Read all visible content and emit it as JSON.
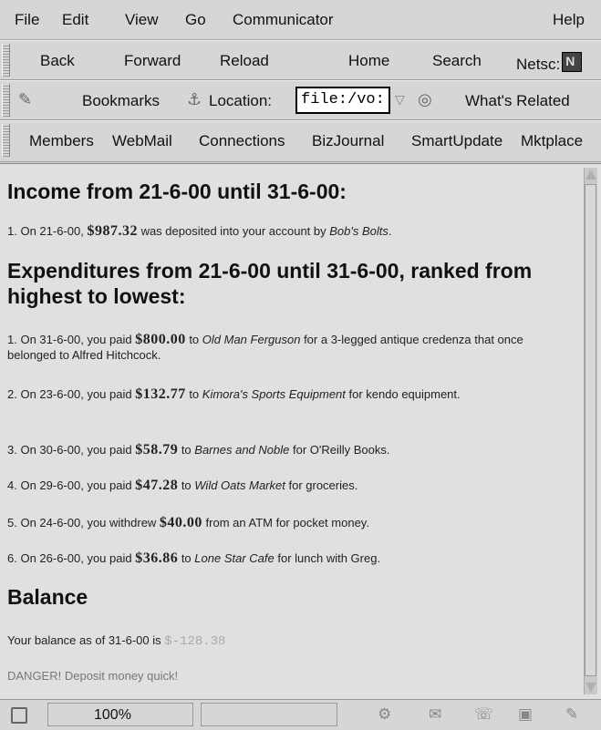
{
  "menubar": {
    "file": "File",
    "edit": "Edit",
    "view": "View",
    "go": "Go",
    "communicator": "Communicator",
    "help": "Help"
  },
  "nav_toolbar": {
    "back": "Back",
    "forward": "Forward",
    "reload": "Reload",
    "home": "Home",
    "search": "Search",
    "netscape": "Netsc:"
  },
  "location_toolbar": {
    "bookmarks": "Bookmarks",
    "location_label": "Location:",
    "location_value": "file:/vo:",
    "whats_related": "What's Related"
  },
  "personal_toolbar": {
    "members": "Members",
    "webmail": "WebMail",
    "connections": "Connections",
    "bizjournal": "BizJournal",
    "smartupdate": "SmartUpdate",
    "mktplace": "Mktplace"
  },
  "page": {
    "income_heading": "Income from 21-6-00 until 31-6-00:",
    "income": [
      {
        "pre": "1. On 21-6-00, ",
        "amount": "$987.32",
        "mid": " was deposited into your account by ",
        "who": "Bob's Bolts",
        "post": "."
      }
    ],
    "expenditure_heading": "Expenditures from 21-6-00 until 31-6-00, ranked from highest to lowest:",
    "expenditures": [
      {
        "pre": "1. On 31-6-00, you paid ",
        "amount": "$800.00",
        "mid": " to ",
        "who": "Old Man Ferguson",
        "post": " for a 3-legged antique credenza that once belonged to Alfred Hitchcock."
      },
      {
        "pre": "2. On 23-6-00, you paid ",
        "amount": "$132.77",
        "mid": " to ",
        "who": "Kimora's Sports Equipment",
        "post": " for kendo equipment."
      },
      {
        "pre": "3. On 30-6-00, you paid ",
        "amount": "$58.79",
        "mid": " to ",
        "who": "Barnes and Noble",
        "post": " for O'Reilly Books."
      },
      {
        "pre": "4. On 29-6-00, you paid ",
        "amount": "$47.28",
        "mid": " to ",
        "who": "Wild Oats Market",
        "post": " for groceries."
      },
      {
        "pre": "5. On 24-6-00, you withdrew ",
        "amount": "$40.00",
        "mid": " from an ATM for pocket money.",
        "who": "",
        "post": ""
      },
      {
        "pre": "6. On 26-6-00, you paid ",
        "amount": "$36.86",
        "mid": " to ",
        "who": "Lone Star Cafe",
        "post": " for lunch with Greg."
      }
    ],
    "balance_heading": "Balance",
    "balance_text": "Your balance as of 31-6-00 is ",
    "balance_value": "$-128.38",
    "warning": "DANGER! Deposit money quick!"
  },
  "status_bar": {
    "zoom": "100%"
  },
  "colors": {
    "chrome": "#d6d6d6",
    "content_bg": "#e0e0e0",
    "negative_balance": "#aaaaaa",
    "warning_text": "#777777"
  }
}
